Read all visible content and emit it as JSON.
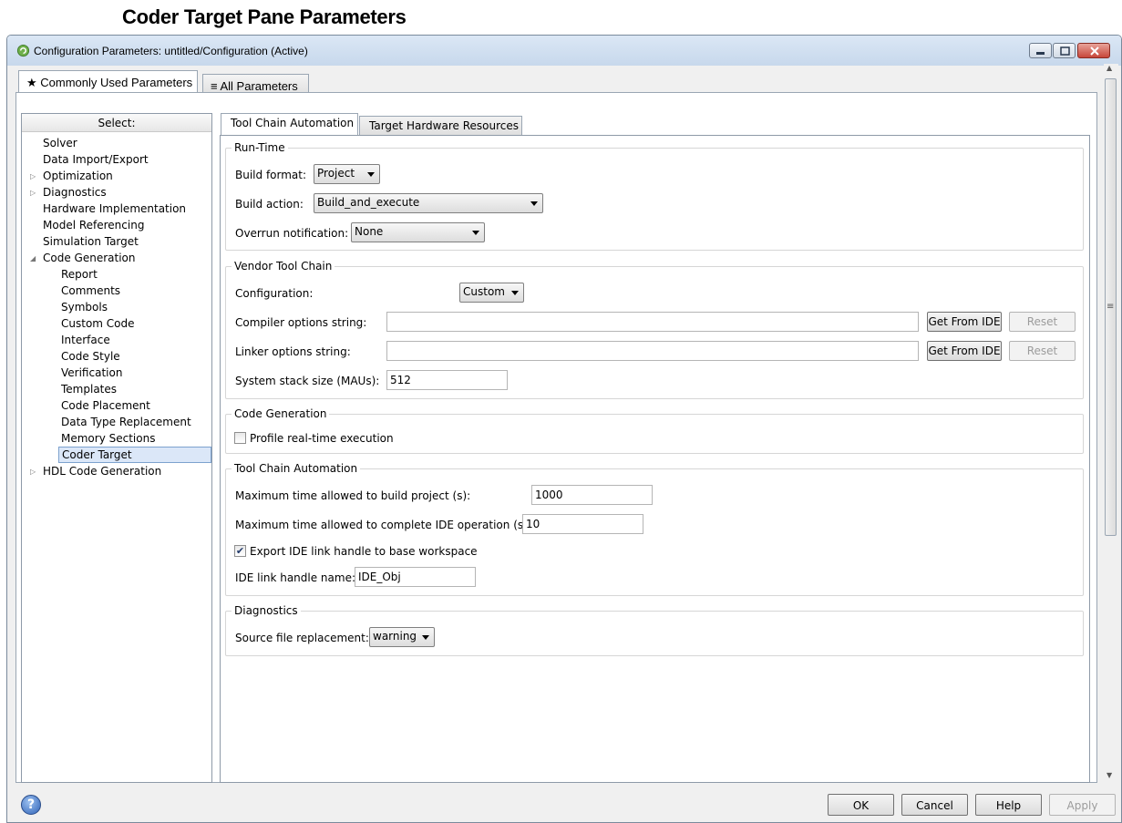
{
  "doc_title": "Coder Target Pane Parameters",
  "window": {
    "title": "Configuration Parameters: untitled/Configuration (Active)"
  },
  "top_tabs": [
    {
      "label": "Commonly Used Parameters",
      "icon": "star-icon",
      "active": true
    },
    {
      "label": "All Parameters",
      "icon": "list-icon",
      "active": false
    }
  ],
  "tree": {
    "header": "Select:",
    "items": [
      {
        "label": "Solver"
      },
      {
        "label": "Data Import/Export"
      },
      {
        "label": "Optimization"
      },
      {
        "label": "Diagnostics"
      },
      {
        "label": "Hardware Implementation"
      },
      {
        "label": "Model Referencing"
      },
      {
        "label": "Simulation Target"
      },
      {
        "label": "Code Generation"
      },
      {
        "label": "Report"
      },
      {
        "label": "Comments"
      },
      {
        "label": "Symbols"
      },
      {
        "label": "Custom Code"
      },
      {
        "label": "Interface"
      },
      {
        "label": "Code Style"
      },
      {
        "label": "Verification"
      },
      {
        "label": "Templates"
      },
      {
        "label": "Code Placement"
      },
      {
        "label": "Data Type Replacement"
      },
      {
        "label": "Memory Sections"
      },
      {
        "label": "Coder Target"
      },
      {
        "label": "HDL Code Generation"
      }
    ],
    "selected": "Coder Target"
  },
  "inner_tabs": [
    {
      "label": "Tool Chain Automation",
      "active": true
    },
    {
      "label": "Target Hardware Resources",
      "active": false
    }
  ],
  "runtime": {
    "title": "Run-Time",
    "build_format_label": "Build format:",
    "build_format_value": "Project",
    "build_action_label": "Build action:",
    "build_action_value": "Build_and_execute",
    "overrun_label": "Overrun notification:",
    "overrun_value": "None"
  },
  "vendor": {
    "title": "Vendor Tool Chain",
    "configuration_label": "Configuration:",
    "configuration_value": "Custom",
    "compiler_label": "Compiler options string:",
    "compiler_value": "",
    "linker_label": "Linker options string:",
    "linker_value": "",
    "get_from_ide": "Get From IDE",
    "reset": "Reset",
    "stack_label": "System stack size (MAUs):",
    "stack_value": "512"
  },
  "codegen": {
    "title": "Code Generation",
    "profile_label": "Profile real-time execution",
    "profile_checked": false
  },
  "tca": {
    "title": "Tool Chain Automation",
    "max_build_label": "Maximum time allowed to build project (s):",
    "max_build_value": "1000",
    "max_ide_label": "Maximum time allowed to complete IDE operation (s):",
    "max_ide_value": "10",
    "export_label": "Export IDE link handle to base workspace",
    "export_checked": true,
    "handle_label": "IDE link handle name:",
    "handle_value": "IDE_Obj"
  },
  "diagnostics": {
    "title": "Diagnostics",
    "source_label": "Source file replacement:",
    "source_value": "warning"
  },
  "buttons": {
    "ok": "OK",
    "cancel": "Cancel",
    "help": "Help",
    "apply": "Apply"
  },
  "colors": {
    "selection": "#dbe7f8",
    "titlebar": "#c7d8ec"
  }
}
